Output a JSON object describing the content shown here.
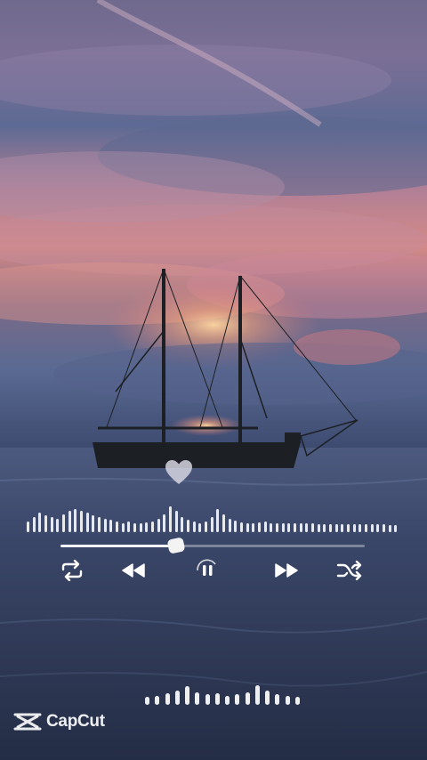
{
  "app": {
    "watermark": "CapCut"
  },
  "colors": {
    "icon": "#ffffff",
    "accent": "#f7e6e6",
    "sky_sunset": "#e79a7a",
    "sea": "#2f3a58"
  },
  "player": {
    "state": "playing",
    "progress": 0.38,
    "controls": [
      {
        "name": "repeat-icon"
      },
      {
        "name": "previous-icon"
      },
      {
        "name": "pause-icon"
      },
      {
        "name": "next-icon"
      },
      {
        "name": "shuffle-icon"
      }
    ]
  },
  "spectrum_levels": [
    0.35,
    0.5,
    0.65,
    0.55,
    0.5,
    0.45,
    0.6,
    0.7,
    0.75,
    0.7,
    0.65,
    0.55,
    0.5,
    0.45,
    0.4,
    0.35,
    0.3,
    0.35,
    0.3,
    0.3,
    0.32,
    0.35,
    0.45,
    0.6,
    0.85,
    0.7,
    0.5,
    0.4,
    0.35,
    0.3,
    0.35,
    0.5,
    0.75,
    0.6,
    0.45,
    0.38,
    0.32,
    0.3,
    0.28,
    0.32,
    0.35,
    0.3,
    0.28,
    0.3,
    0.3,
    0.28,
    0.28,
    0.3,
    0.28,
    0.27,
    0.27,
    0.27,
    0.26,
    0.26,
    0.26,
    0.26,
    0.26,
    0.26,
    0.25,
    0.25,
    0.25,
    0.24,
    0.24
  ],
  "secondary_levels": [
    0.35,
    0.4,
    0.5,
    0.6,
    0.8,
    0.55,
    0.45,
    0.5,
    0.4,
    0.45,
    0.55,
    0.85,
    0.6,
    0.45,
    0.4,
    0.35
  ]
}
